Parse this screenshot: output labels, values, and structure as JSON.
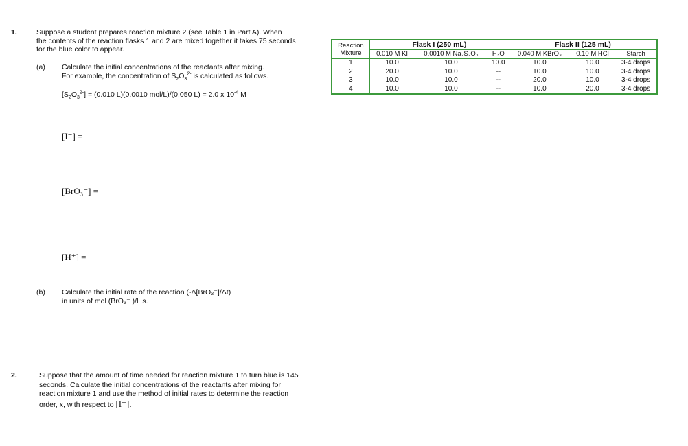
{
  "q1": {
    "number": "1.",
    "text": [
      "Suppose a student prepares reaction mixture 2 (see Table 1 in Part A).  When",
      "the contents of the reaction flasks 1 and 2 are mixed together it takes 75 seconds",
      "for the blue color to appear."
    ],
    "a": {
      "label": "(a)",
      "line1": "Calculate the initial concentrations of the reactants after mixing.",
      "line2": "For example, the concentration of S",
      "line2_end": " is calculated as follows.",
      "example": "= (0.010 L)(0.0010 mol/L)/(0.050 L) = 2.0 x 10",
      "example_exp": "-4",
      "example_unit": " M",
      "iodide": "[I⁻] =",
      "bromate": "[BrO₃⁻] =",
      "hydrogen": "[H⁺] ="
    },
    "b": {
      "label": "(b)",
      "line1": "Calculate the initial rate of the reaction (-Δ[BrO₃⁻]/Δt)",
      "line2": "in units of mol (BrO₃⁻ )/L s."
    }
  },
  "q2": {
    "number": "2.",
    "text": [
      "Suppose that the amount of time needed for reaction mixture 1 to turn blue is 145",
      "seconds.  Calculate the initial concentrations of the reactants after mixing for",
      "reaction mixture 1 and use the method of initial rates to determine the reaction"
    ],
    "last": "order, x, with respect to ",
    "last_term": "[I⁻]."
  },
  "table": {
    "col0": [
      "Reaction",
      "Mixture"
    ],
    "flask1": "Flask I (250 mL)",
    "flask2": "Flask II (125 mL)",
    "subheaders": [
      "0.010 M KI",
      "0.0010 M Na₂S₂O₃",
      "H₂O",
      "0.040 M KBrO₃",
      "0.10 M HCl",
      "Starch"
    ],
    "rows": [
      [
        "1",
        "10.0",
        "10.0",
        "10.0",
        "10.0",
        "10.0",
        "3-4 drops"
      ],
      [
        "2",
        "20.0",
        "10.0",
        "--",
        "10.0",
        "10.0",
        "3-4 drops"
      ],
      [
        "3",
        "10.0",
        "10.0",
        "--",
        "20.0",
        "10.0",
        "3-4 drops"
      ],
      [
        "4",
        "10.0",
        "10.0",
        "--",
        "10.0",
        "20.0",
        "3-4 drops"
      ]
    ]
  },
  "colors": {
    "table_border": "#3c9a3c"
  }
}
